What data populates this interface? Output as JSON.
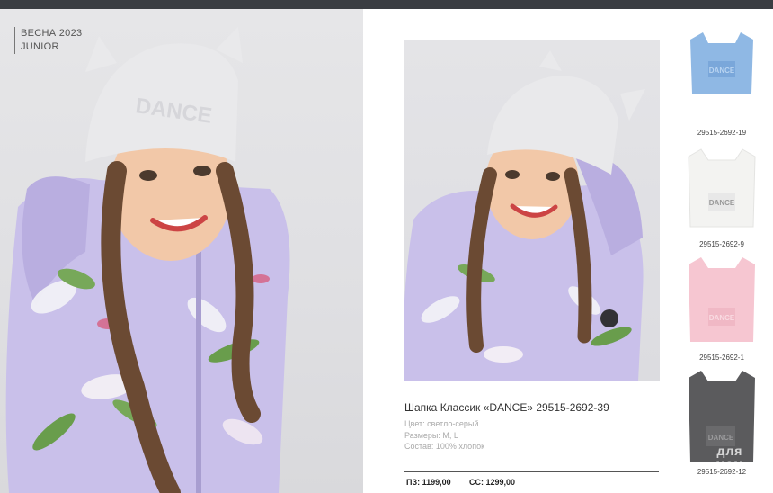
{
  "header": {
    "season_line1": "ВЕСНА 2023",
    "season_line2": "JUNIOR"
  },
  "product": {
    "title": "Шапка Классик «DANCE» 29515-2692-39",
    "color": "Цвет: светло-серый",
    "sizes": "Размеры: M, L",
    "composition": "Состав: 100% хлопок",
    "price_pz": "ПЗ: 1199,00",
    "price_ss": "СС: 1299,00"
  },
  "variants": [
    {
      "code": "29515-2692-19",
      "color": "#8fb8e4",
      "print": "DANCE",
      "icon": "hat-cat-ears-blue-icon"
    },
    {
      "code": "29515-2692-9",
      "color": "#f3f3f1",
      "print": "DANCE",
      "icon": "hat-cat-ears-white-icon"
    },
    {
      "code": "29515-2692-1",
      "color": "#f6c6d1",
      "print": "DANCE",
      "icon": "hat-cat-ears-pink-icon"
    },
    {
      "code": "29515-2692-12",
      "color": "#5b5b5d",
      "print": "DANCE",
      "icon": "hat-cat-ears-grey-icon"
    }
  ],
  "watermark": {
    "line1": "для",
    "line2": "мам"
  },
  "colors": {
    "topbar": "#3a3d42",
    "jacket": "#c9c0ea",
    "hat": "#e9e9eb",
    "hair": "#6b4a33"
  }
}
